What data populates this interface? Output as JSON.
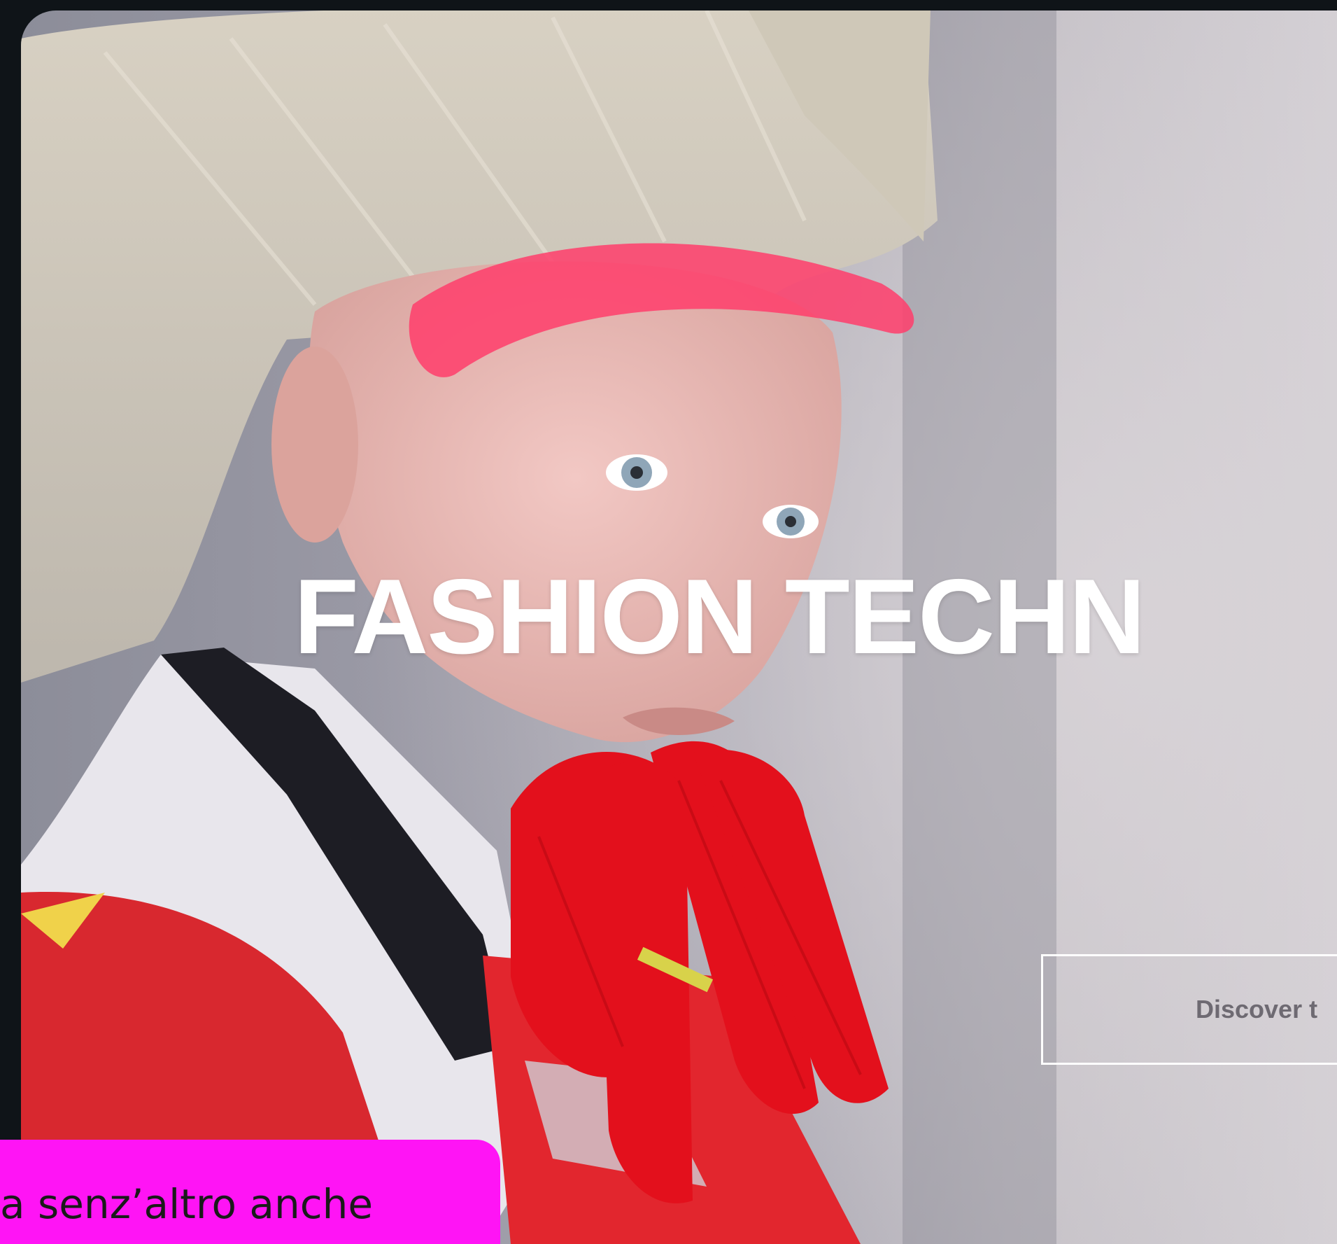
{
  "hero": {
    "title": "FASHION TECHN",
    "cta_label": "Discover t"
  },
  "caption": {
    "text": "a senz’altro anche"
  },
  "colors": {
    "background": "#0f1418",
    "caption_bg": "#ff14f5",
    "title": "#ffffff"
  }
}
